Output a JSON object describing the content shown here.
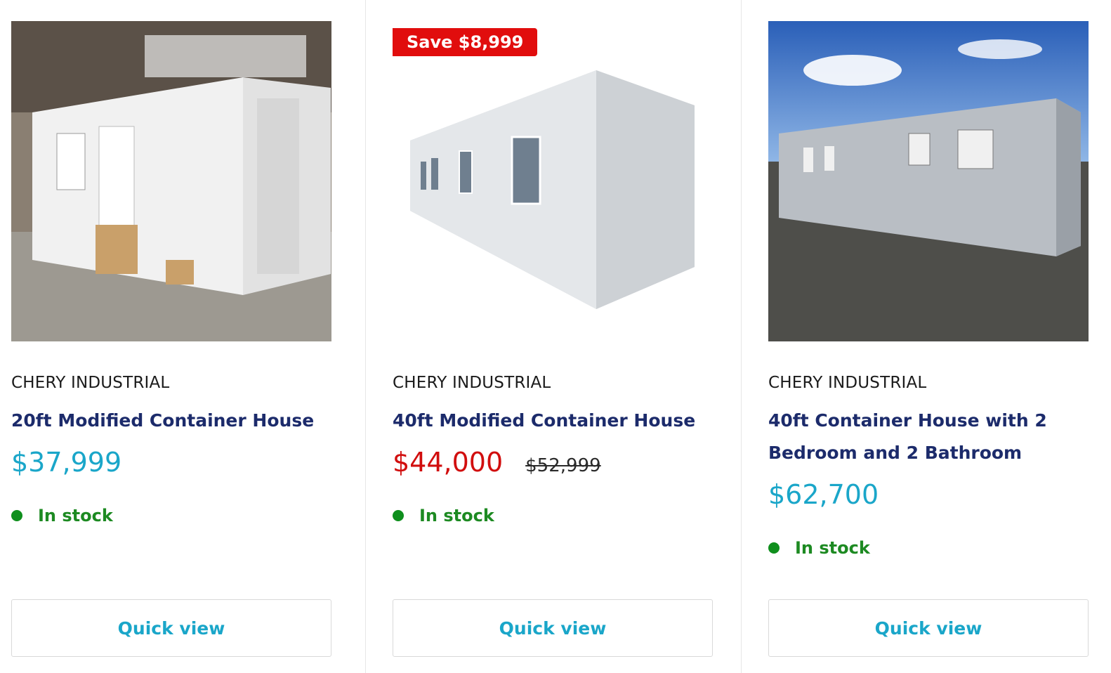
{
  "products": [
    {
      "vendor": "CHERY INDUSTRIAL",
      "title": "20ft Modified Container House",
      "price": "$37,999",
      "stock": "In stock",
      "quick_view": "Quick view"
    },
    {
      "badge": "Save $8,999",
      "vendor": "CHERY INDUSTRIAL",
      "title": "40ft Modified Container House",
      "price": "$44,000",
      "compare_price": "$52,999",
      "stock": "In stock",
      "quick_view": "Quick view"
    },
    {
      "vendor": "CHERY INDUSTRIAL",
      "title": "40ft Container House with 2 Bedroom and 2 Bathroom",
      "price": "$62,700",
      "stock": "In stock",
      "quick_view": "Quick view"
    }
  ],
  "colors": {
    "title": "#1c2b6b",
    "price": "#1aa6c9",
    "sale_price": "#d10e0e",
    "badge": "#e10d0d",
    "stock": "#1d8a22"
  }
}
